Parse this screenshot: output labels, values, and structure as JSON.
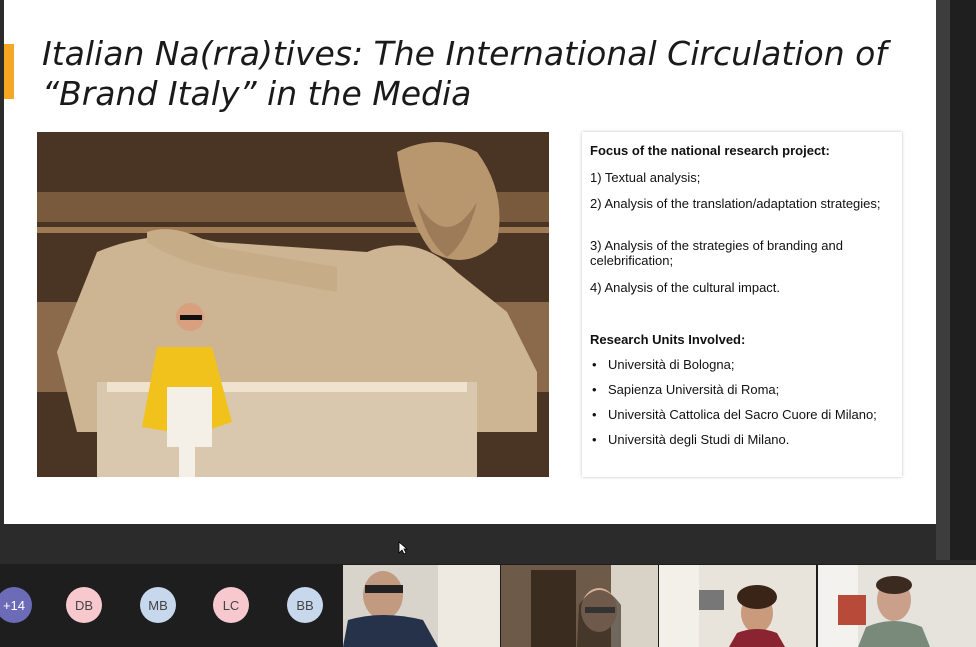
{
  "slide": {
    "title_line1": "Italian Na(rra)tives: The International Circulation of",
    "title_line2": "“Brand Italy” in the Media",
    "accent_color": "#f5a623",
    "focus_heading": "Focus of the national research project:",
    "focus_items": [
      "1) Textual analysis;",
      "2) Analysis of the translation/adaptation strategies;",
      "3) Analysis of the strategies of branding and celebrification;",
      "4) Analysis of the cultural impact."
    ],
    "units_heading": "Research Units Involved:",
    "units": [
      "Università di Bologna;",
      "Sapienza Università di Roma;",
      "Università Cattolica del Sacro Cuore di Milano;",
      "Università degli Studi di Milano."
    ]
  },
  "participants": {
    "overflow_count": "+14",
    "avatars": [
      {
        "initials": "DB",
        "color": "#f7c9cf"
      },
      {
        "initials": "MB",
        "color": "#c7d7ec"
      },
      {
        "initials": "LC",
        "color": "#f7c9cf"
      },
      {
        "initials": "BB",
        "color": "#c7d7ec"
      }
    ],
    "overflow_color": "#6b6bb8"
  }
}
